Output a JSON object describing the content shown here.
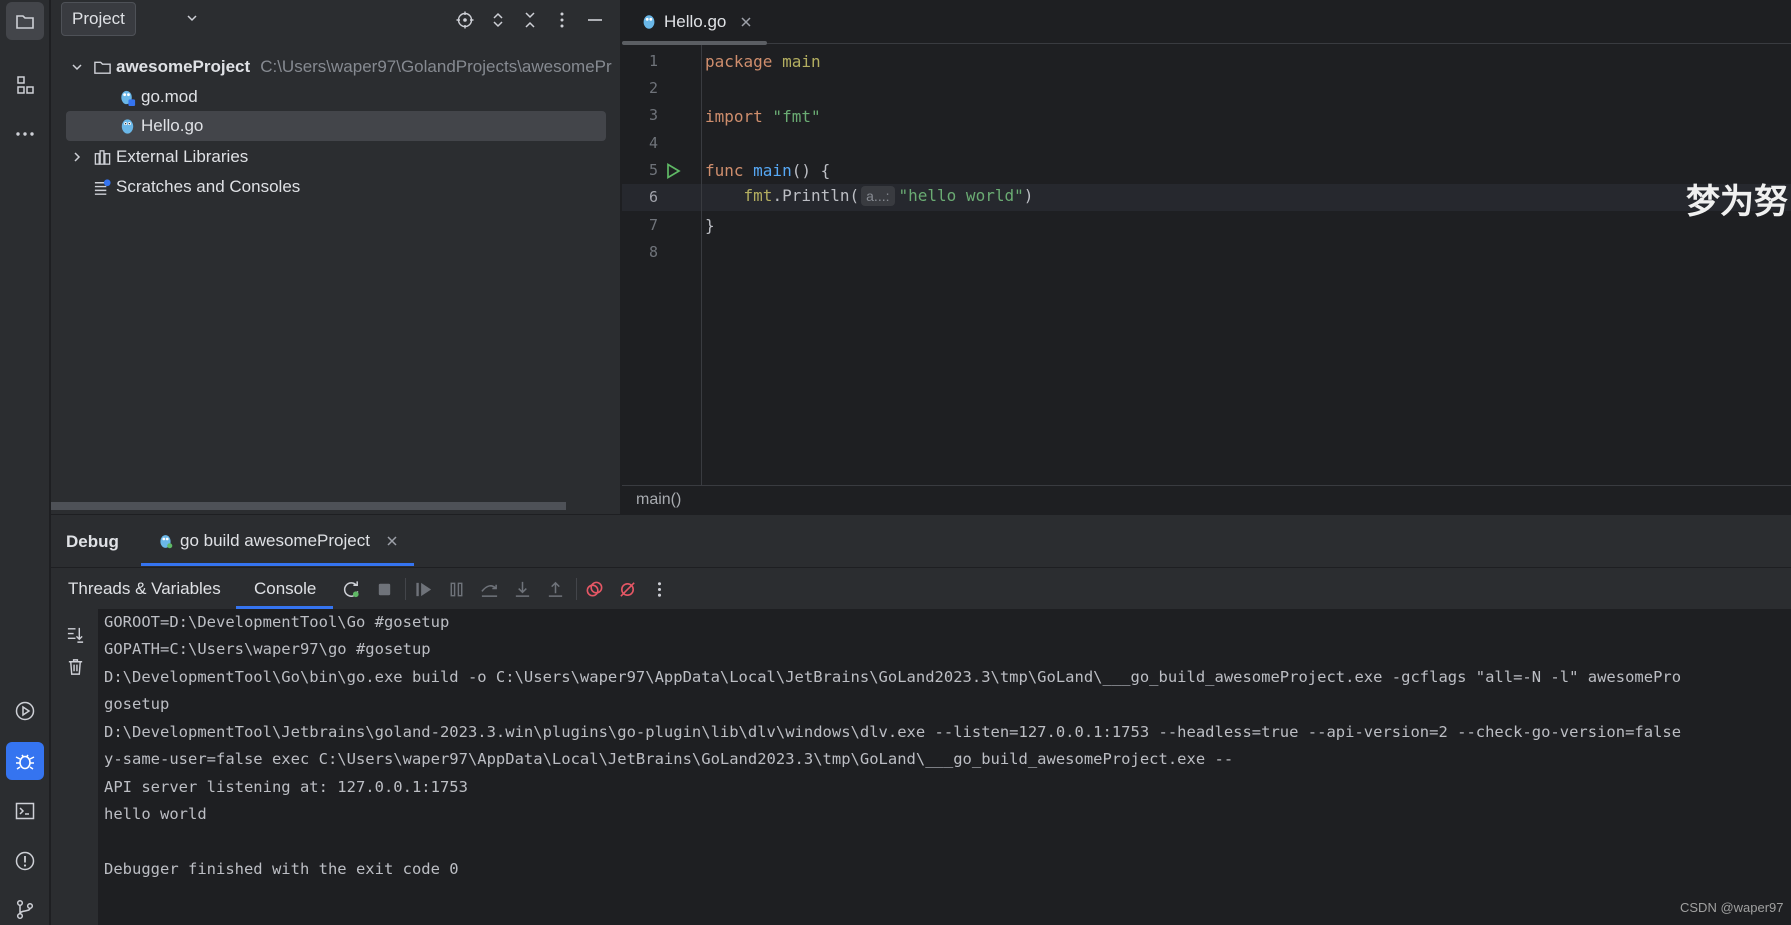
{
  "colors": {
    "accent": "#3574f0",
    "keyword": "#cf8e6d",
    "string": "#6aab73",
    "function": "#56a8f5",
    "package": "#b3ae60"
  },
  "activity_bar": {
    "icons": [
      "project-icon",
      "structure-icon",
      "more-icon",
      "run-icon",
      "debug-icon",
      "terminal-icon",
      "problems-icon",
      "git-icon"
    ]
  },
  "project": {
    "title": "Project",
    "tree": [
      {
        "label": "awesomeProject",
        "path": "C:\\Users\\waper97\\GolandProjects\\awesomePr",
        "icon": "folder-icon"
      },
      {
        "label": "go.mod",
        "icon": "gomod-file-icon"
      },
      {
        "label": "Hello.go",
        "icon": "go-file-icon"
      },
      {
        "label": "External Libraries",
        "icon": "libraries-icon"
      },
      {
        "label": "Scratches and Consoles",
        "icon": "scratches-icon"
      }
    ]
  },
  "editor": {
    "tab_label": "Hello.go",
    "line_numbers": [
      "1",
      "2",
      "3",
      "4",
      "5",
      "6",
      "7",
      "8"
    ],
    "code": {
      "l1_kw": "package",
      "l1_name": " main",
      "l3_kw": "import",
      "l3_str": " \"fmt\"",
      "l5_kw": "func",
      "l5_fn": " main",
      "l5_rest": "() {",
      "l6_indent": "    ",
      "l6_pkg": "fmt",
      "l6_call": ".Println(",
      "l6_hint": "a...:",
      "l6_str": "\"hello world\"",
      "l6_close": ")",
      "l7": "}"
    },
    "overlay_text": "梦为努",
    "breadcrumb": "main()"
  },
  "debug": {
    "title": "Debug",
    "session_tab": "go build awesomeProject",
    "tabs": {
      "threads": "Threads & Variables",
      "console": "Console"
    },
    "console_lines": [
      "GOROOT=D:\\DevelopmentTool\\Go #gosetup",
      "GOPATH=C:\\Users\\waper97\\go #gosetup",
      "D:\\DevelopmentTool\\Go\\bin\\go.exe build -o C:\\Users\\waper97\\AppData\\Local\\JetBrains\\GoLand2023.3\\tmp\\GoLand\\___go_build_awesomeProject.exe -gcflags \"all=-N -l\" awesomePro",
      "gosetup",
      "D:\\DevelopmentTool\\Jetbrains\\goland-2023.3.win\\plugins\\go-plugin\\lib\\dlv\\windows\\dlv.exe --listen=127.0.0.1:1753 --headless=true --api-version=2 --check-go-version=false",
      "y-same-user=false exec C:\\Users\\waper97\\AppData\\Local\\JetBrains\\GoLand2023.3\\tmp\\GoLand\\___go_build_awesomeProject.exe --",
      "API server listening at: 127.0.0.1:1753",
      "hello world",
      "",
      "Debugger finished with the exit code 0"
    ]
  },
  "watermark": "CSDN @waper97"
}
